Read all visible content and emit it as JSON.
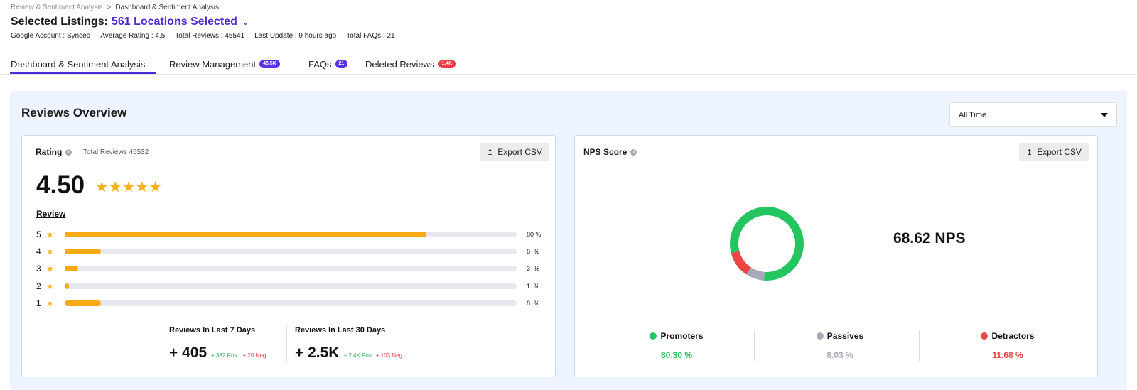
{
  "breadcrumb": {
    "parent": "Review & Sentiment Analysis",
    "separator": ">",
    "current": "Dashboard & Sentiment Analysis"
  },
  "header": {
    "label": "Selected Listings:",
    "value": "561 Locations Selected",
    "meta": {
      "google_account": "Google Account : Synced",
      "average_rating": "Average Rating : 4.5",
      "total_reviews": "Total Reviews : 45541",
      "last_update": "Last Update : 9 hours ago",
      "total_faqs": "Total FAQs : 21"
    }
  },
  "tabs": {
    "dashboard": {
      "label": "Dashboard & Sentiment Analysis"
    },
    "review_management": {
      "label": "Review Management",
      "badge": "45.5K"
    },
    "faqs": {
      "label": "FAQs",
      "badge": "21"
    },
    "deleted_reviews": {
      "label": "Deleted Reviews",
      "badge": "1.4K"
    }
  },
  "overview": {
    "title": "Reviews Overview",
    "period": "All Time"
  },
  "rating_card": {
    "title": "Rating",
    "subtitle": "Total Reviews 45532",
    "export_label": "Export CSV",
    "rating": "4.50",
    "stars": "★★★★★",
    "review_link": "Review",
    "distribution": [
      {
        "star": "5",
        "fraction": 0.8,
        "pct": "80 %"
      },
      {
        "star": "4",
        "fraction": 0.08,
        "pct": "8  %"
      },
      {
        "star": "3",
        "fraction": 0.03,
        "pct": "3  %"
      },
      {
        "star": "2",
        "fraction": 0.01,
        "pct": "1  %"
      },
      {
        "star": "1",
        "fraction": 0.08,
        "pct": "8  %"
      }
    ],
    "last7": {
      "title": "Reviews In Last 7 Days",
      "value": "+ 405",
      "pos": "+ 382 Pos.",
      "neg": "+ 20 Neg."
    },
    "last30": {
      "title": "Reviews In Last 30 Days",
      "value": "+ 2.5K",
      "pos": "+ 2.4K Pos",
      "neg": "+ 103 Neg"
    }
  },
  "nps_card": {
    "title": "NPS Score",
    "export_label": "Export CSV",
    "score": "68.62 NPS",
    "segments": [
      {
        "label": "Promoters",
        "pct": "80.30 %",
        "fraction": 0.803,
        "color": "#22c55e"
      },
      {
        "label": "Passives",
        "pct": "8.03 %",
        "fraction": 0.0803,
        "color": "#a8a8b8"
      },
      {
        "label": "Detractors",
        "pct": "11.68 %",
        "fraction": 0.1168,
        "color": "#ef4444"
      }
    ]
  },
  "colors": {
    "accent": "#4b2bd6",
    "star": "#f7b21a",
    "bar": "#f7aa14",
    "positive": "#2ab15a",
    "negative": "#ee3b44"
  }
}
